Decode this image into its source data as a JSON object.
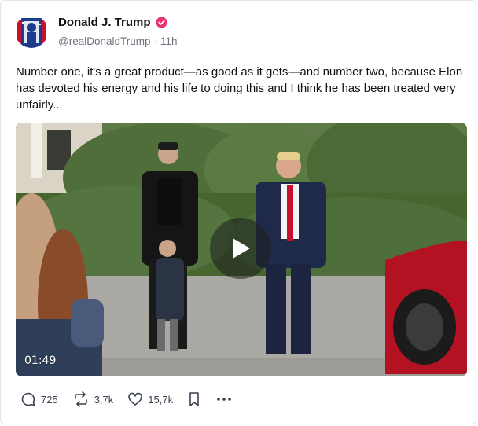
{
  "author": {
    "name": "Donald J. Trump",
    "handle": "@realDonaldTrump",
    "separator": "·",
    "time": "11h"
  },
  "post": {
    "text": "Number one, it's a great product—as good as it gets—and number two, because Elon has devoted his energy and his life to doing this and I think he has been treated very unfairly..."
  },
  "video": {
    "duration": "01:49"
  },
  "actions": {
    "replies": "725",
    "reposts": "3,7k",
    "likes": "15,7k"
  },
  "colors": {
    "verified": "#e8336b",
    "text_muted": "#6b7280"
  }
}
